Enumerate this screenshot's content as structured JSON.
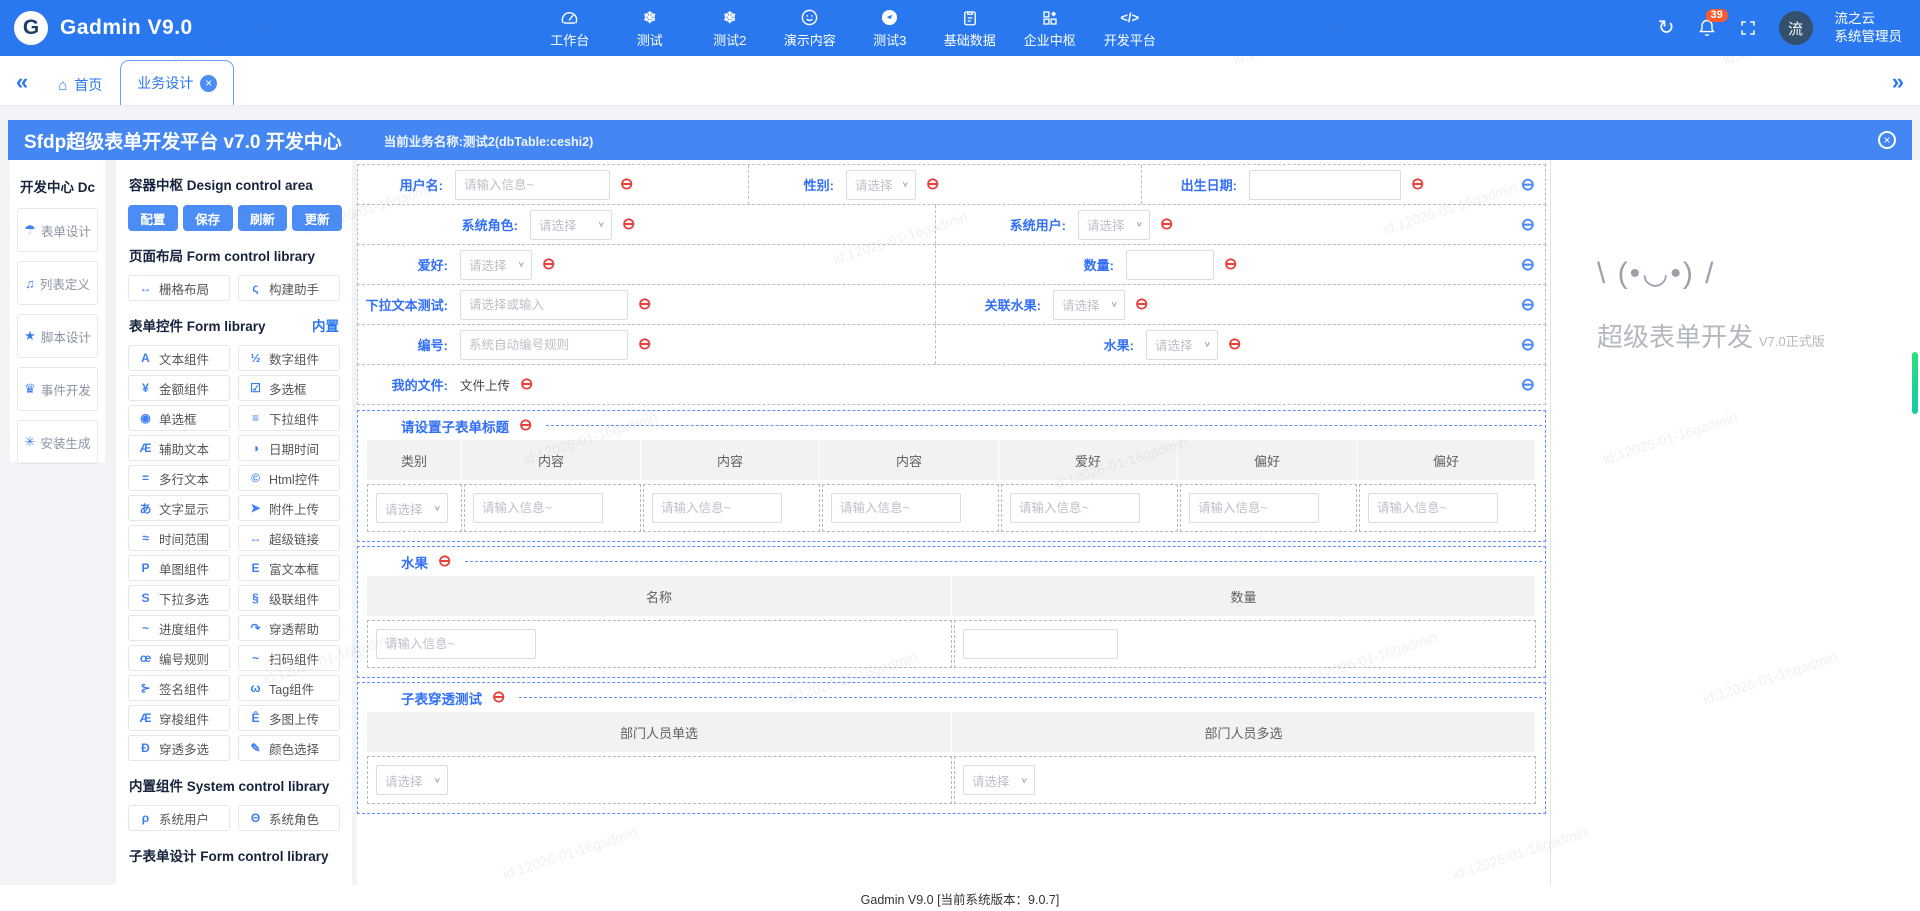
{
  "watermark": {
    "text": "id:12026-01-16gadmin"
  },
  "icons": {
    "minus": "⊖",
    "caret": "∨",
    "close": "×",
    "refresh": "↻",
    "home": "⌂",
    "chevrons_left": "«",
    "chevrons_right": "»",
    "snowflake": "❄",
    "smiley": "☺",
    "code": "</>"
  },
  "navbar": {
    "title": "Gadmin V9.0",
    "logo_letter": "G",
    "menu": [
      {
        "label": "工作台"
      },
      {
        "label": "测试"
      },
      {
        "label": "测试2"
      },
      {
        "label": "演示内容"
      },
      {
        "label": "测试3"
      },
      {
        "label": "基础数据"
      },
      {
        "label": "企业中枢"
      },
      {
        "label": "开发平台"
      }
    ],
    "notification_count": "39",
    "user": {
      "avatar_letter": "流",
      "org": "流之云",
      "role": "系统管理员"
    }
  },
  "tabbar": {
    "tabs": [
      {
        "label": "首页"
      },
      {
        "label": "业务设计"
      }
    ]
  },
  "page_header": {
    "title": "Sfdp超级表单开发平台 v7.0 开发中心",
    "business": "当前业务名称:测试2(dbTable:ceshi2)"
  },
  "sidebar": {
    "title": "开发中心 Dc",
    "items": [
      {
        "icon": "☂",
        "label": "表单设计"
      },
      {
        "icon": "♫",
        "label": "列表定义"
      },
      {
        "icon": "★",
        "label": "脚本设计"
      },
      {
        "icon": "♛",
        "label": "事件开发"
      },
      {
        "icon": "✳",
        "label": "安装生成"
      }
    ]
  },
  "library": {
    "section_container": "容器中枢 Design control area",
    "toolbar": [
      "配置",
      "保存",
      "刷新",
      "更新"
    ],
    "section_layout": "页面布局 Form control library",
    "layout_items": [
      {
        "icon": "↔",
        "label": "栅格布局"
      },
      {
        "icon": "ς",
        "label": "构建助手"
      }
    ],
    "section_form": "表单控件 Form library",
    "builtin_link": "内置",
    "form_items": [
      {
        "icon": "A",
        "label": "文本组件"
      },
      {
        "icon": "½",
        "label": "数字组件"
      },
      {
        "icon": "¥",
        "label": "金额组件"
      },
      {
        "icon": "☑",
        "label": "多选框"
      },
      {
        "icon": "◉",
        "label": "单选框"
      },
      {
        "icon": "≡",
        "label": "下拉组件"
      },
      {
        "icon": "Æ",
        "label": "辅助文本"
      },
      {
        "icon": "◑",
        "label": "日期时间"
      },
      {
        "icon": "=",
        "label": "多行文本"
      },
      {
        "icon": "©",
        "label": "Html控件"
      },
      {
        "icon": "あ",
        "label": "文字显示"
      },
      {
        "icon": "➤",
        "label": "附件上传"
      },
      {
        "icon": "≈",
        "label": "时间范围"
      },
      {
        "icon": "↔",
        "label": "超级链接"
      },
      {
        "icon": "P",
        "label": "单图组件"
      },
      {
        "icon": "E",
        "label": "富文本框"
      },
      {
        "icon": "S",
        "label": "下拉多选"
      },
      {
        "icon": "§",
        "label": "级联组件"
      },
      {
        "icon": "~",
        "label": "进度组件"
      },
      {
        "icon": "↷",
        "label": "穿透帮助"
      },
      {
        "icon": "œ",
        "label": "编号规则"
      },
      {
        "icon": "~",
        "label": "扫码组件"
      },
      {
        "icon": "⊱",
        "label": "签名组件"
      },
      {
        "icon": "ω",
        "label": "Tag组件"
      },
      {
        "icon": "Æ",
        "label": "穿梭组件"
      },
      {
        "icon": "Ê",
        "label": "多图上传"
      },
      {
        "icon": "Ð",
        "label": "穿透多选"
      },
      {
        "icon": "✎",
        "label": "颜色选择"
      }
    ],
    "section_system": "内置组件 System control library",
    "system_items": [
      {
        "icon": "ρ",
        "label": "系统用户"
      },
      {
        "icon": "Θ",
        "label": "系统角色"
      }
    ],
    "section_subform": "子表单设计 Form control library"
  },
  "canvas": {
    "rows": [
      {
        "cells": [
          {
            "label": "用户名:",
            "type": "input",
            "placeholder": "请输入信息~"
          },
          {
            "label": "性别:",
            "type": "select",
            "placeholder": "请选择"
          },
          {
            "label": "出生日期:",
            "type": "input",
            "placeholder": ""
          }
        ]
      },
      {
        "cells": [
          {
            "label": "系统角色:",
            "type": "select",
            "placeholder": "请选择"
          },
          {
            "label": "系统用户:",
            "type": "select",
            "placeholder": "请选择"
          }
        ]
      },
      {
        "cells": [
          {
            "label": "爱好:",
            "type": "select",
            "placeholder": "请选择"
          },
          {
            "label": "数量:",
            "type": "input",
            "placeholder": ""
          }
        ]
      },
      {
        "cells": [
          {
            "label": "下拉文本测试:",
            "type": "input",
            "placeholder": "请选择或输入"
          },
          {
            "label": "关联水果:",
            "type": "select",
            "placeholder": "请选择"
          }
        ]
      },
      {
        "cells": [
          {
            "label": "编号:",
            "type": "input",
            "placeholder": "系统自动编号规则"
          },
          {
            "label": "水果:",
            "type": "select",
            "placeholder": "请选择"
          }
        ]
      },
      {
        "cells": [
          {
            "label": "我的文件:",
            "type": "text",
            "value": "文件上传"
          }
        ]
      }
    ],
    "subtables": [
      {
        "title": "请设置子表单标题",
        "columns": [
          "类别",
          "内容",
          "内容",
          "内容",
          "爱好",
          "偏好",
          "偏好"
        ],
        "row": [
          {
            "type": "select",
            "placeholder": "请选择"
          },
          {
            "type": "input",
            "placeholder": "请输入信息~"
          },
          {
            "type": "input",
            "placeholder": "请输入信息~"
          },
          {
            "type": "input",
            "placeholder": "请输入信息~"
          },
          {
            "type": "input",
            "placeholder": "请输入信息~"
          },
          {
            "type": "input",
            "placeholder": "请输入信息~"
          },
          {
            "type": "input",
            "placeholder": "请输入信息~"
          }
        ]
      },
      {
        "title": "水果",
        "columns": [
          "名称",
          "数量"
        ],
        "row": [
          {
            "type": "input",
            "placeholder": "请输入信息~"
          },
          {
            "type": "input",
            "placeholder": ""
          }
        ]
      },
      {
        "title": "子表穿透测试",
        "columns": [
          "部门人员单选",
          "部门人员多选"
        ],
        "row": [
          {
            "type": "select",
            "placeholder": "请选择"
          },
          {
            "type": "select",
            "placeholder": "请选择"
          }
        ]
      }
    ]
  },
  "aside": {
    "emoticon": "\\ (•◡•) /",
    "product": "超级表单开发",
    "version": "V7.0正式版"
  },
  "footer": {
    "text": "Gadmin V9.0 [当前系统版本：9.0.7]"
  }
}
